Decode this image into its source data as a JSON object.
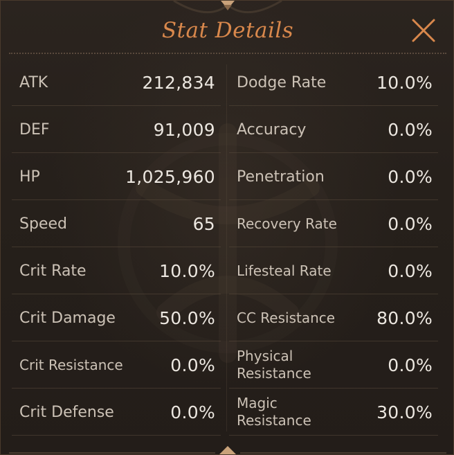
{
  "window": {
    "title": "Stat Details",
    "close_icon": "close-icon"
  },
  "colors": {
    "title": "#d9884c",
    "label": "#ccc2b6",
    "value": "#ece7e0",
    "background": "#26201b"
  },
  "stats_left": [
    {
      "label": "ATK",
      "value": "212,834"
    },
    {
      "label": "DEF",
      "value": "91,009"
    },
    {
      "label": "HP",
      "value": "1,025,960"
    },
    {
      "label": "Speed",
      "value": "65"
    },
    {
      "label": "Crit Rate",
      "value": "10.0%"
    },
    {
      "label": "Crit Damage",
      "value": "50.0%"
    },
    {
      "label": "Crit Resistance",
      "value": "0.0%"
    },
    {
      "label": "Crit Defense",
      "value": "0.0%"
    }
  ],
  "stats_right": [
    {
      "label": "Dodge Rate",
      "value": "10.0%"
    },
    {
      "label": "Accuracy",
      "value": "0.0%"
    },
    {
      "label": "Penetration",
      "value": "0.0%"
    },
    {
      "label": "Recovery Rate",
      "value": "0.0%"
    },
    {
      "label": "Lifesteal Rate",
      "value": "0.0%"
    },
    {
      "label": "CC Resistance",
      "value": "80.0%"
    },
    {
      "label": "Physical Resistance",
      "value": "0.0%"
    },
    {
      "label": "Magic Resistance",
      "value": "30.0%"
    }
  ]
}
